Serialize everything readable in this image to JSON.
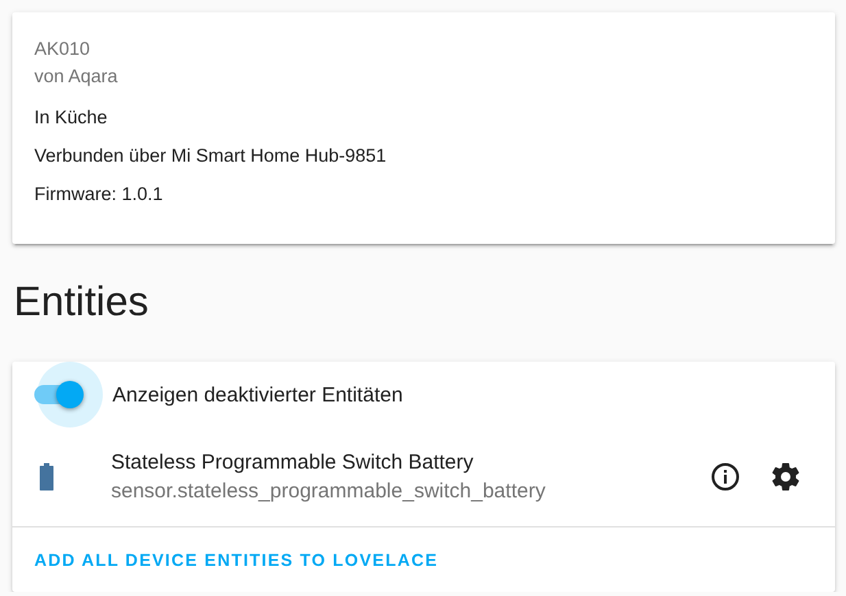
{
  "device_card": {
    "model": "AK010",
    "manufacturer": "von Aqara",
    "area": "In Küche",
    "connection": "Verbunden über Mi Smart Home Hub-9851",
    "firmware": "Firmware: 1.0.1"
  },
  "entities_heading": "Entities",
  "entities_card": {
    "toggle": {
      "label": "Anzeigen deaktivierter Entitäten",
      "on": true
    },
    "entities": [
      {
        "name": "Stateless Programmable Switch Battery",
        "entity_id": "sensor.stateless_programmable_switch_battery"
      }
    ],
    "action": "ADD ALL DEVICE ENTITIES TO LOVELACE"
  }
}
